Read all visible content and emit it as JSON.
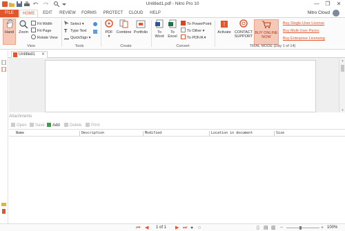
{
  "window": {
    "title": "Untitled1.pdf - Nitro Pro 10",
    "minimize": "—",
    "maximize": "❐",
    "close": "✕"
  },
  "tabs": [
    {
      "label": "FILE"
    },
    {
      "label": "HOME"
    },
    {
      "label": "EDIT"
    },
    {
      "label": "REVIEW"
    },
    {
      "label": "FORMS"
    },
    {
      "label": "PROTECT"
    },
    {
      "label": "CLOUD"
    },
    {
      "label": "HELP"
    }
  ],
  "account": {
    "label": "Nitro Cloud"
  },
  "ribbon": {
    "view": {
      "label": "View",
      "hand": "Hand",
      "zoom": "Zoom",
      "fit_width": "Fit Width",
      "fit_page": "Fit Page",
      "rotate_view": "Rotate View"
    },
    "tools": {
      "label": "Tools",
      "select": "Select",
      "type_text": "Type Text",
      "quicksign": "QuickSign"
    },
    "create": {
      "label": "Create",
      "pdf": "PDF",
      "combine": "Combine",
      "portfolio": "Portfolio"
    },
    "convert": {
      "label": "Convert",
      "to_word_1": "To",
      "to_word_2": "Word",
      "to_excel_1": "To",
      "to_excel_2": "Excel",
      "to_powerpoint": "To PowerPoint",
      "to_other": "To Other",
      "to_pdfa": "To PDF/A"
    },
    "trial": {
      "label": "TRIAL MODE (Day 1 of 14)",
      "activate": "Activate",
      "contact_1": "CONTACT",
      "contact_2": "SUPPORT",
      "buy_1": "BUY ONLINE",
      "buy_2": "NOW",
      "link_single": "Buy Single-User License",
      "link_multi": "Buy Multi-User Packs",
      "link_enterprise": "Buy Enterprise Licensing"
    }
  },
  "document": {
    "tab_label": "Untitled1",
    "tab_close": "✕"
  },
  "attachments": {
    "header": "Attachments",
    "toolbar": {
      "open": "Open",
      "save": "Save",
      "add": "Add",
      "delete": "Delete",
      "print": "Print"
    },
    "columns": [
      "Name",
      "Description",
      "Modified",
      "Location in document",
      "Size"
    ]
  },
  "status": {
    "page_indicator": "1 of 1",
    "zoom": "100%"
  },
  "colors": {
    "accent": "#e2562c",
    "highlight": "#f5c8b7"
  }
}
